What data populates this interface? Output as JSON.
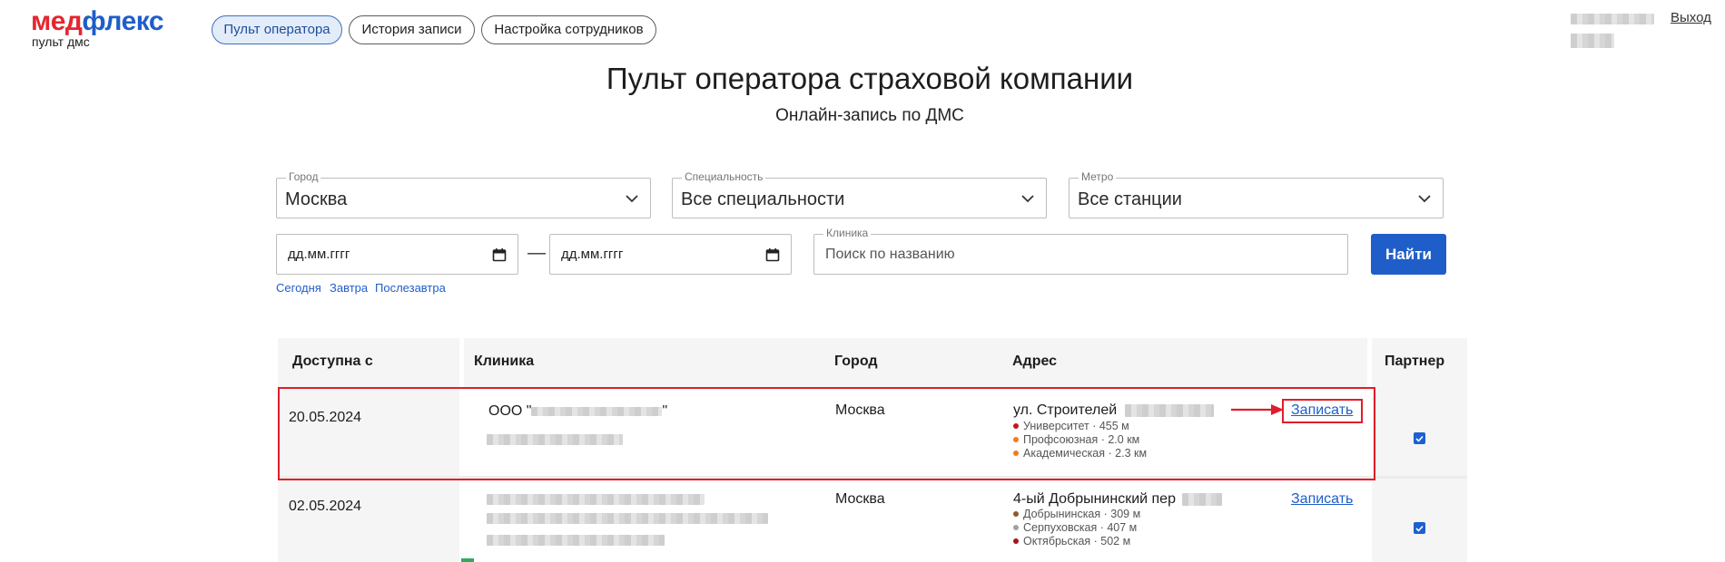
{
  "header": {
    "logo_part1": "мед",
    "logo_part2": "флекс",
    "logo_sub": "пульт дмс",
    "nav": [
      {
        "label": "Пульт оператора",
        "active": true
      },
      {
        "label": "История записи",
        "active": false
      },
      {
        "label": "Настройка сотрудников",
        "active": false
      }
    ],
    "logout": "Выход"
  },
  "page": {
    "title": "Пульт оператора страховой компании",
    "subtitle": "Онлайн-запись по ДМС"
  },
  "filters": {
    "city": {
      "label": "Город",
      "value": "Москва"
    },
    "specialty": {
      "label": "Специальность",
      "value": "Все специальности"
    },
    "metro": {
      "label": "Метро",
      "value": "Все станции"
    },
    "date_from": "дд.мм.гггг",
    "date_to": "дд.мм.гггг",
    "date_separator": "—",
    "clinic": {
      "label": "Клиника",
      "placeholder": "Поиск по названию"
    },
    "find_button": "Найти",
    "quick_dates": [
      "Сегодня",
      "Завтра",
      "Послезавтра"
    ]
  },
  "table": {
    "headers": {
      "available": "Доступна с",
      "clinic": "Клиника",
      "city": "Город",
      "address": "Адрес",
      "partner": "Партнер"
    },
    "rows": [
      {
        "available": "20.05.2024",
        "clinic_prefix": "ООО \"",
        "clinic_suffix": "\"",
        "city": "Москва",
        "address": "ул. Строителей",
        "metro": [
          {
            "name": "Университет · 455 м",
            "color": "#c4151c"
          },
          {
            "name": "Профсоюзная · 2.0 км",
            "color": "#f07e16"
          },
          {
            "name": "Академическая · 2.3 км",
            "color": "#f07e16"
          }
        ],
        "book": "Записать",
        "partner": true
      },
      {
        "available": "02.05.2024",
        "city": "Москва",
        "address": "4-ый Добрынинский пер",
        "metro": [
          {
            "name": "Добрынинская · 309 м",
            "color": "#8d5b2d"
          },
          {
            "name": "Серпуховская · 407 м",
            "color": "#a0a2a3"
          },
          {
            "name": "Октябрьская · 502 м",
            "color": "#a6141c"
          }
        ],
        "book": "Записать",
        "partner": true
      }
    ]
  },
  "colors": {
    "brand_red": "#e4262f",
    "brand_blue": "#1f5ec9",
    "highlight_red": "#e01d2a"
  }
}
